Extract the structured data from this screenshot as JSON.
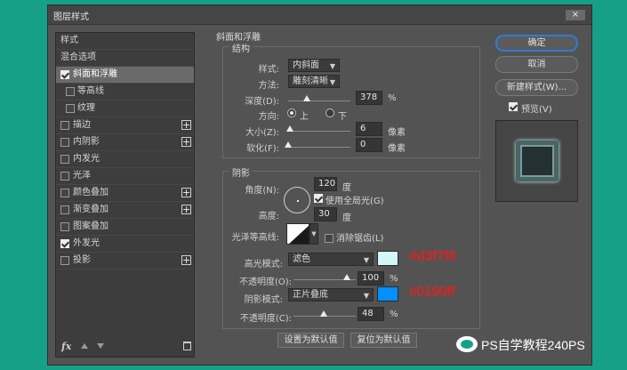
{
  "dialog": {
    "title": "图层样式",
    "close_label": "×"
  },
  "styles_panel": {
    "header": "样式",
    "blend_options": "混合选项",
    "items": [
      {
        "label": "斜面和浮雕",
        "checked": true,
        "selected": true,
        "has_plus": false
      },
      {
        "label": "等高线",
        "checked": false,
        "sub": true
      },
      {
        "label": "纹理",
        "checked": false,
        "sub": true
      },
      {
        "label": "描边",
        "checked": false,
        "has_plus": true
      },
      {
        "label": "内阴影",
        "checked": false,
        "has_plus": true
      },
      {
        "label": "内发光",
        "checked": false
      },
      {
        "label": "光泽",
        "checked": false
      },
      {
        "label": "颜色叠加",
        "checked": false,
        "has_plus": true
      },
      {
        "label": "渐变叠加",
        "checked": false,
        "has_plus": true
      },
      {
        "label": "图案叠加",
        "checked": false
      },
      {
        "label": "外发光",
        "checked": true
      },
      {
        "label": "投影",
        "checked": false,
        "has_plus": true
      }
    ],
    "fx_label": "fx"
  },
  "bevel": {
    "group_title": "斜面和浮雕",
    "structure_title": "结构",
    "style_label": "样式:",
    "style_value": "内斜面",
    "technique_label": "方法:",
    "technique_value": "雕刻清晰",
    "depth_label": "深度(D):",
    "depth_value": "378",
    "depth_unit": "%",
    "depth_fraction": 0.378,
    "direction_label": "方向:",
    "dir_up": "上",
    "dir_down": "下",
    "size_label": "大小(Z):",
    "size_value": "6",
    "size_unit": "像素",
    "size_fraction": 0.025,
    "soften_label": "软化(F):",
    "soften_value": "0",
    "soften_unit": "像素",
    "soften_fraction": 0.0
  },
  "shading": {
    "title": "阴影",
    "angle_label": "角度(N):",
    "angle_value": "120",
    "angle_unit": "度",
    "global_light_label": "使用全局光(G)",
    "altitude_label": "高度:",
    "altitude_value": "30",
    "altitude_unit": "度",
    "gloss_label": "光泽等高线:",
    "antialias_label": "消除锯齿(L)",
    "highlight_mode_label": "高光模式:",
    "highlight_mode_value": "滤色",
    "highlight_color": "#d3f7f8",
    "highlight_hex": "#d3f7f8",
    "highlight_opacity_label": "不透明度(O):",
    "highlight_opacity_value": "100",
    "highlight_opacity_fraction": 1.0,
    "shadow_mode_label": "阴影模式:",
    "shadow_mode_value": "正片叠底",
    "shadow_color": "#0190ff",
    "shadow_hex": "#0190ff",
    "shadow_opacity_label": "不透明度(C):",
    "shadow_opacity_value": "48",
    "shadow_opacity_fraction": 0.48,
    "percent": "%"
  },
  "footer": {
    "make_default": "设置为默认值",
    "reset_default": "复位为默认值"
  },
  "right": {
    "ok": "确定",
    "cancel": "取消",
    "new_style": "新建样式(W)...",
    "preview_label": "预览(V)"
  },
  "watermark": "PS自学教程240PS"
}
